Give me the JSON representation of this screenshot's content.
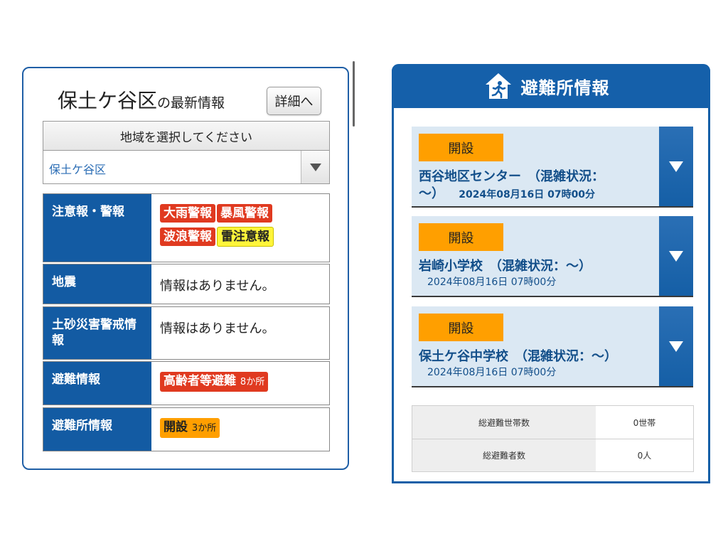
{
  "left": {
    "area_name": "保土ケ谷区",
    "title_suffix": "の最新情報",
    "detail_button": "詳細へ",
    "region_header": "地域を選択してください",
    "region_selected": "保土ケ谷区",
    "rows": {
      "warnings": {
        "label": "注意報・警報",
        "badges": [
          "大雨警報",
          "暴風警報",
          "波浪警報",
          "雷注意報"
        ]
      },
      "earthquake": {
        "label": "地震",
        "text": "情報はありません。"
      },
      "landslide": {
        "label": "土砂災害警戒情報",
        "text": "情報はありません。"
      },
      "evacuation": {
        "label": "避難情報",
        "badge": "高齢者等避難",
        "count": "8か所"
      },
      "shelter": {
        "label": "避難所情報",
        "badge": "開設",
        "count": "3か所"
      }
    }
  },
  "right": {
    "header_title": "避難所情報",
    "header_icon": "evacuation-exit-icon",
    "shelters": [
      {
        "status": "開設",
        "name": "西谷地区センター　（混雑状況：",
        "name_cont": "〜）",
        "date": "2024年08月16日 07時00分"
      },
      {
        "status": "開設",
        "name": "岩崎小学校　（混雑状況：〜）",
        "date": "2024年08月16日 07時00分"
      },
      {
        "status": "開設",
        "name": "保土ケ谷中学校　（混雑状況：〜）",
        "date": "2024年08月16日 07時00分"
      }
    ],
    "summary": [
      {
        "label": "総避難世帯数",
        "value": "0世帯"
      },
      {
        "label": "総避難者数",
        "value": "0人"
      }
    ]
  },
  "colors": {
    "brand_blue": "#135ba3",
    "warning_red": "#e03a20",
    "advisory_yellow": "#fff53a",
    "open_orange": "#ff9f00",
    "shelter_bg": "#dbe8f3"
  }
}
